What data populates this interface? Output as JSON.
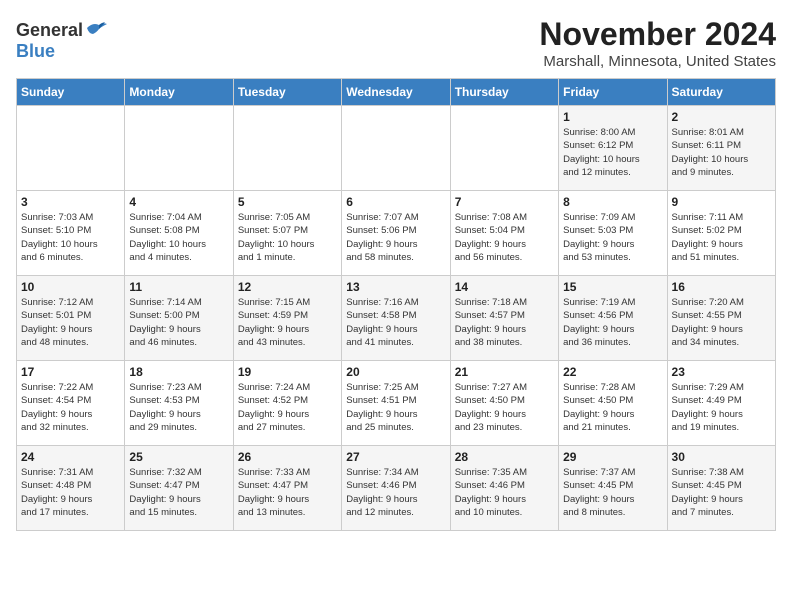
{
  "header": {
    "logo_general": "General",
    "logo_blue": "Blue",
    "month_year": "November 2024",
    "location": "Marshall, Minnesota, United States"
  },
  "days_of_week": [
    "Sunday",
    "Monday",
    "Tuesday",
    "Wednesday",
    "Thursday",
    "Friday",
    "Saturday"
  ],
  "weeks": [
    [
      {
        "day": "",
        "info": ""
      },
      {
        "day": "",
        "info": ""
      },
      {
        "day": "",
        "info": ""
      },
      {
        "day": "",
        "info": ""
      },
      {
        "day": "",
        "info": ""
      },
      {
        "day": "1",
        "info": "Sunrise: 8:00 AM\nSunset: 6:12 PM\nDaylight: 10 hours\nand 12 minutes."
      },
      {
        "day": "2",
        "info": "Sunrise: 8:01 AM\nSunset: 6:11 PM\nDaylight: 10 hours\nand 9 minutes."
      }
    ],
    [
      {
        "day": "3",
        "info": "Sunrise: 7:03 AM\nSunset: 5:10 PM\nDaylight: 10 hours\nand 6 minutes."
      },
      {
        "day": "4",
        "info": "Sunrise: 7:04 AM\nSunset: 5:08 PM\nDaylight: 10 hours\nand 4 minutes."
      },
      {
        "day": "5",
        "info": "Sunrise: 7:05 AM\nSunset: 5:07 PM\nDaylight: 10 hours\nand 1 minute."
      },
      {
        "day": "6",
        "info": "Sunrise: 7:07 AM\nSunset: 5:06 PM\nDaylight: 9 hours\nand 58 minutes."
      },
      {
        "day": "7",
        "info": "Sunrise: 7:08 AM\nSunset: 5:04 PM\nDaylight: 9 hours\nand 56 minutes."
      },
      {
        "day": "8",
        "info": "Sunrise: 7:09 AM\nSunset: 5:03 PM\nDaylight: 9 hours\nand 53 minutes."
      },
      {
        "day": "9",
        "info": "Sunrise: 7:11 AM\nSunset: 5:02 PM\nDaylight: 9 hours\nand 51 minutes."
      }
    ],
    [
      {
        "day": "10",
        "info": "Sunrise: 7:12 AM\nSunset: 5:01 PM\nDaylight: 9 hours\nand 48 minutes."
      },
      {
        "day": "11",
        "info": "Sunrise: 7:14 AM\nSunset: 5:00 PM\nDaylight: 9 hours\nand 46 minutes."
      },
      {
        "day": "12",
        "info": "Sunrise: 7:15 AM\nSunset: 4:59 PM\nDaylight: 9 hours\nand 43 minutes."
      },
      {
        "day": "13",
        "info": "Sunrise: 7:16 AM\nSunset: 4:58 PM\nDaylight: 9 hours\nand 41 minutes."
      },
      {
        "day": "14",
        "info": "Sunrise: 7:18 AM\nSunset: 4:57 PM\nDaylight: 9 hours\nand 38 minutes."
      },
      {
        "day": "15",
        "info": "Sunrise: 7:19 AM\nSunset: 4:56 PM\nDaylight: 9 hours\nand 36 minutes."
      },
      {
        "day": "16",
        "info": "Sunrise: 7:20 AM\nSunset: 4:55 PM\nDaylight: 9 hours\nand 34 minutes."
      }
    ],
    [
      {
        "day": "17",
        "info": "Sunrise: 7:22 AM\nSunset: 4:54 PM\nDaylight: 9 hours\nand 32 minutes."
      },
      {
        "day": "18",
        "info": "Sunrise: 7:23 AM\nSunset: 4:53 PM\nDaylight: 9 hours\nand 29 minutes."
      },
      {
        "day": "19",
        "info": "Sunrise: 7:24 AM\nSunset: 4:52 PM\nDaylight: 9 hours\nand 27 minutes."
      },
      {
        "day": "20",
        "info": "Sunrise: 7:25 AM\nSunset: 4:51 PM\nDaylight: 9 hours\nand 25 minutes."
      },
      {
        "day": "21",
        "info": "Sunrise: 7:27 AM\nSunset: 4:50 PM\nDaylight: 9 hours\nand 23 minutes."
      },
      {
        "day": "22",
        "info": "Sunrise: 7:28 AM\nSunset: 4:50 PM\nDaylight: 9 hours\nand 21 minutes."
      },
      {
        "day": "23",
        "info": "Sunrise: 7:29 AM\nSunset: 4:49 PM\nDaylight: 9 hours\nand 19 minutes."
      }
    ],
    [
      {
        "day": "24",
        "info": "Sunrise: 7:31 AM\nSunset: 4:48 PM\nDaylight: 9 hours\nand 17 minutes."
      },
      {
        "day": "25",
        "info": "Sunrise: 7:32 AM\nSunset: 4:47 PM\nDaylight: 9 hours\nand 15 minutes."
      },
      {
        "day": "26",
        "info": "Sunrise: 7:33 AM\nSunset: 4:47 PM\nDaylight: 9 hours\nand 13 minutes."
      },
      {
        "day": "27",
        "info": "Sunrise: 7:34 AM\nSunset: 4:46 PM\nDaylight: 9 hours\nand 12 minutes."
      },
      {
        "day": "28",
        "info": "Sunrise: 7:35 AM\nSunset: 4:46 PM\nDaylight: 9 hours\nand 10 minutes."
      },
      {
        "day": "29",
        "info": "Sunrise: 7:37 AM\nSunset: 4:45 PM\nDaylight: 9 hours\nand 8 minutes."
      },
      {
        "day": "30",
        "info": "Sunrise: 7:38 AM\nSunset: 4:45 PM\nDaylight: 9 hours\nand 7 minutes."
      }
    ]
  ]
}
